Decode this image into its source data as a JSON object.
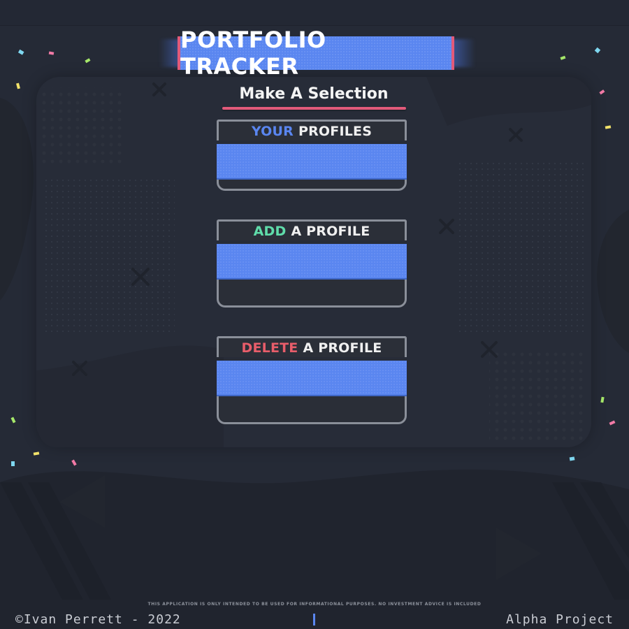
{
  "header": {
    "title": "PORTFOLIO TRACKER"
  },
  "main": {
    "selection_title": "Make A Selection",
    "cards": [
      {
        "accent_word": "YOUR",
        "rest": "PROFILES",
        "accent_color": "#5a86f0"
      },
      {
        "accent_word": "ADD",
        "rest": "A PROFILE",
        "accent_color": "#5fdcaa"
      },
      {
        "accent_word": "DELETE",
        "rest": "A PROFILE",
        "accent_color": "#e85d6a"
      }
    ]
  },
  "footer": {
    "disclaimer": "THIS APPLICATION IS ONLY INTENDED TO BE USED FOR INFORMATIONAL PURPOSES. NO INVESTMENT ADVICE IS INCLUDED",
    "copyright": "©Ivan Perrett - 2022",
    "project": "Alpha Project"
  },
  "colors": {
    "background": "#252a36",
    "accent_blue": "#5a86f0",
    "accent_pink": "#e25a7a"
  }
}
